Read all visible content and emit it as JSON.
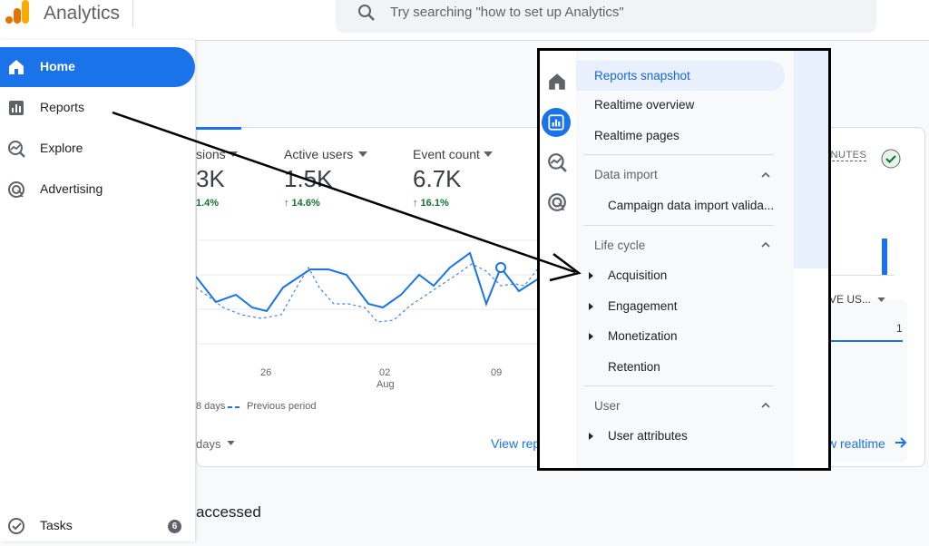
{
  "header": {
    "app_title": "Analytics",
    "search_placeholder": "Try searching \"how to set up Analytics\""
  },
  "nav": {
    "items": [
      {
        "label": "Home"
      },
      {
        "label": "Reports"
      },
      {
        "label": "Explore"
      },
      {
        "label": "Advertising"
      }
    ],
    "tasks": {
      "label": "Tasks",
      "count": "6"
    }
  },
  "card": {
    "metrics": [
      {
        "label": "sions",
        "value": "3K",
        "delta": "1.4%"
      },
      {
        "label": "Active users",
        "value": "1.5K",
        "delta": "↑ 14.6%"
      },
      {
        "label": "Event count",
        "value": "6.7K",
        "delta": "↑ 16.1%"
      }
    ],
    "x_ticks": [
      "26",
      "02",
      "09"
    ],
    "x_month": "Aug",
    "legend_current": "8 days",
    "legend_previous": "Previous period",
    "date_range": "days",
    "view_reports": "View rep",
    "realtime_label": "INUTES",
    "realtime_sub": "VE US...",
    "realtime_value": "1",
    "view_realtime": "w realtime"
  },
  "footer_title": "accessed",
  "menu": {
    "top_items": [
      "Reports snapshot",
      "Realtime overview",
      "Realtime pages"
    ],
    "sections": [
      {
        "title": "Data import",
        "items": [
          "Campaign data import valida..."
        ]
      },
      {
        "title": "Life cycle",
        "items": [
          "Acquisition",
          "Engagement",
          "Monetization",
          "Retention"
        ]
      },
      {
        "title": "User",
        "items": [
          "User attributes"
        ]
      }
    ]
  },
  "colors": {
    "accent": "#1a73e8",
    "positive": "#137333",
    "annotation": "#000000"
  }
}
